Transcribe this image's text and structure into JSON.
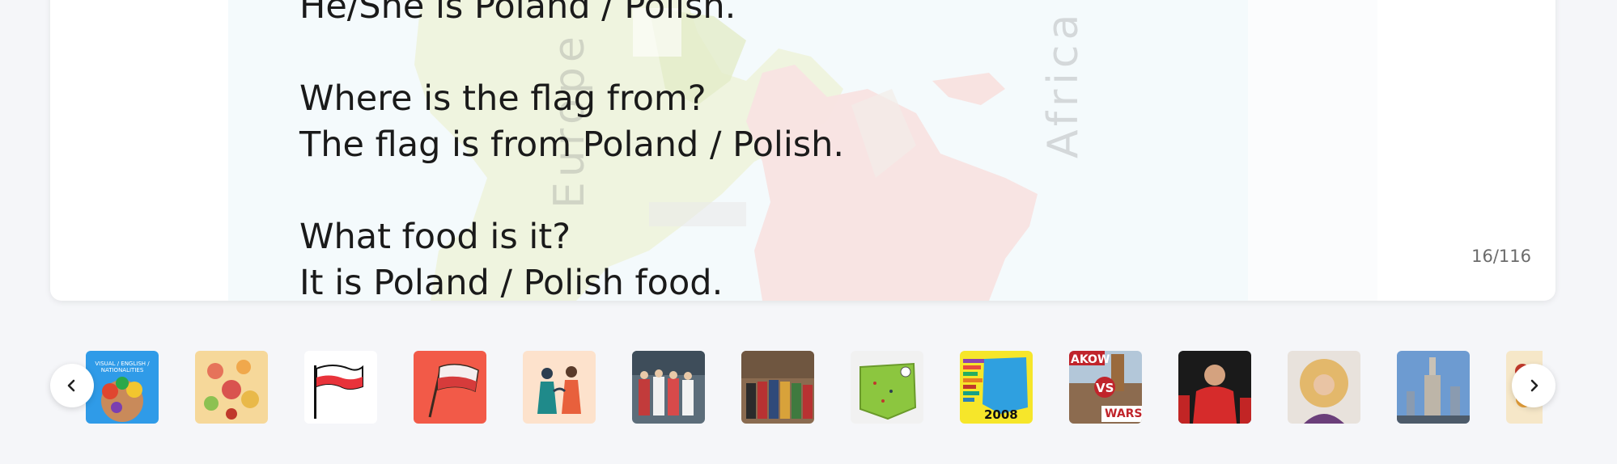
{
  "slide": {
    "lines": [
      "He/She is Poland / Polish.",
      "Where is the flag from?",
      "The flag is from Poland / Polish.",
      "What food is it?",
      "It is Poland / Polish food."
    ],
    "map_labels": {
      "europe": "Europe",
      "africa": "Africa"
    }
  },
  "pager": {
    "counter": "16/116"
  },
  "thumbnails": {
    "prev_icon": "chevron-left-icon",
    "next_icon": "chevron-right-icon",
    "items": [
      {
        "name": "thumb-nationalities",
        "caption": "VISUAL / ENGLISH / NATIONALITIES"
      },
      {
        "name": "thumb-food-map"
      },
      {
        "name": "thumb-flag-drawing"
      },
      {
        "name": "thumb-flag-red"
      },
      {
        "name": "thumb-people"
      },
      {
        "name": "thumb-folk-dancers"
      },
      {
        "name": "thumb-folk-group"
      },
      {
        "name": "thumb-map-game"
      },
      {
        "name": "thumb-chart-2008",
        "caption": "2008"
      },
      {
        "name": "thumb-krakow-vs-warsaw",
        "caption_top": "AKOW",
        "caption_mid": "VS",
        "caption_bottom": "WARS"
      },
      {
        "name": "thumb-football-player"
      },
      {
        "name": "thumb-singer"
      },
      {
        "name": "thumb-palace-of-culture"
      },
      {
        "name": "thumb-partial"
      }
    ]
  },
  "colors": {
    "accent_red": "#dc143c",
    "flag_red": "#e8333b",
    "thumb_orange": "#f25a48"
  }
}
